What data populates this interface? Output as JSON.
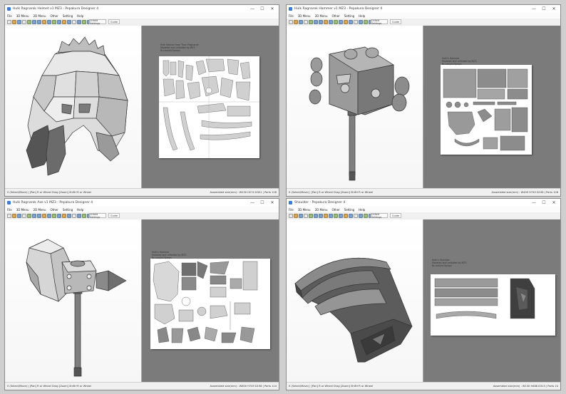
{
  "menu_items": [
    "File",
    "3D Menu",
    "2D Menu",
    "Other",
    "Setting",
    "Help"
  ],
  "tab_buttons": [
    "Unfold Settings",
    "Guide"
  ],
  "window_controls": [
    "—",
    "☐",
    "✕"
  ],
  "windows": [
    {
      "title": "Hulk Ragnarok Helmet v1 MZ3 - Pepakura Designer 4",
      "paper_text": [
        "Hulk Helmet from Thor: Ragnarok",
        "Modeled and unfolded by MZ3",
        "fb.com/mz3props"
      ],
      "status_left": "0 (Select/Move) | [Pan] R or Wheel Drag [Zoom] Shift+R or Wheel",
      "status_right": "Assembled size(mm) : W230 H274 D301 | Parts 128"
    },
    {
      "title": "Hulk Ragnarok Hammer v1 MZ3 - Pepakura Designer 4",
      "paper_text": [
        "Hulk's Hammer",
        "Modeled and unfolded by MZ3",
        "fb.com/mz3props"
      ],
      "status_left": "0 (Select/Move) | [Pan] R or Wheel Drag [Zoom] Shift+R or Wheel",
      "status_right": "Assembled size(mm) : W400 H749 D198 | Parts 108"
    },
    {
      "title": "Hulk Ragnarok Axe v1 MZ3 - Pepakura Designer 4",
      "paper_text": [
        "Hulk's Hammer",
        "Modeled and unfolded by MZ3",
        "fb.com/mz3props"
      ],
      "status_left": "0 (Select/Move) | [Pan] R or Wheel Drag [Zoom] Shift+R or Wheel",
      "status_right": "Assembled size(mm) : W800 H749 D198 | Parts 114"
    },
    {
      "title": "Shoulder - Pepakura Designer 4",
      "paper_text": [
        "Hulk's Shoulder",
        "Modeled and unfolded by MZ3",
        "fb.com/mz3props"
      ],
      "status_left": "0 (Select/Move) | [Pan] R or Wheel Drag [Zoom] Shift+R or Wheel",
      "status_right": "Assembled size(mm) : W130 H488 D313 | Parts 24"
    }
  ],
  "icons": {
    "app": "pepakura-app-icon",
    "toolbar": [
      "new-file-icon",
      "open-icon",
      "save-icon",
      "print-icon",
      "unfold-icon",
      "undo-icon",
      "redo-icon",
      "select-icon",
      "rotate-icon",
      "join-icon",
      "flap-icon",
      "texture-icon",
      "zoom-icon",
      "settings-icon"
    ]
  }
}
